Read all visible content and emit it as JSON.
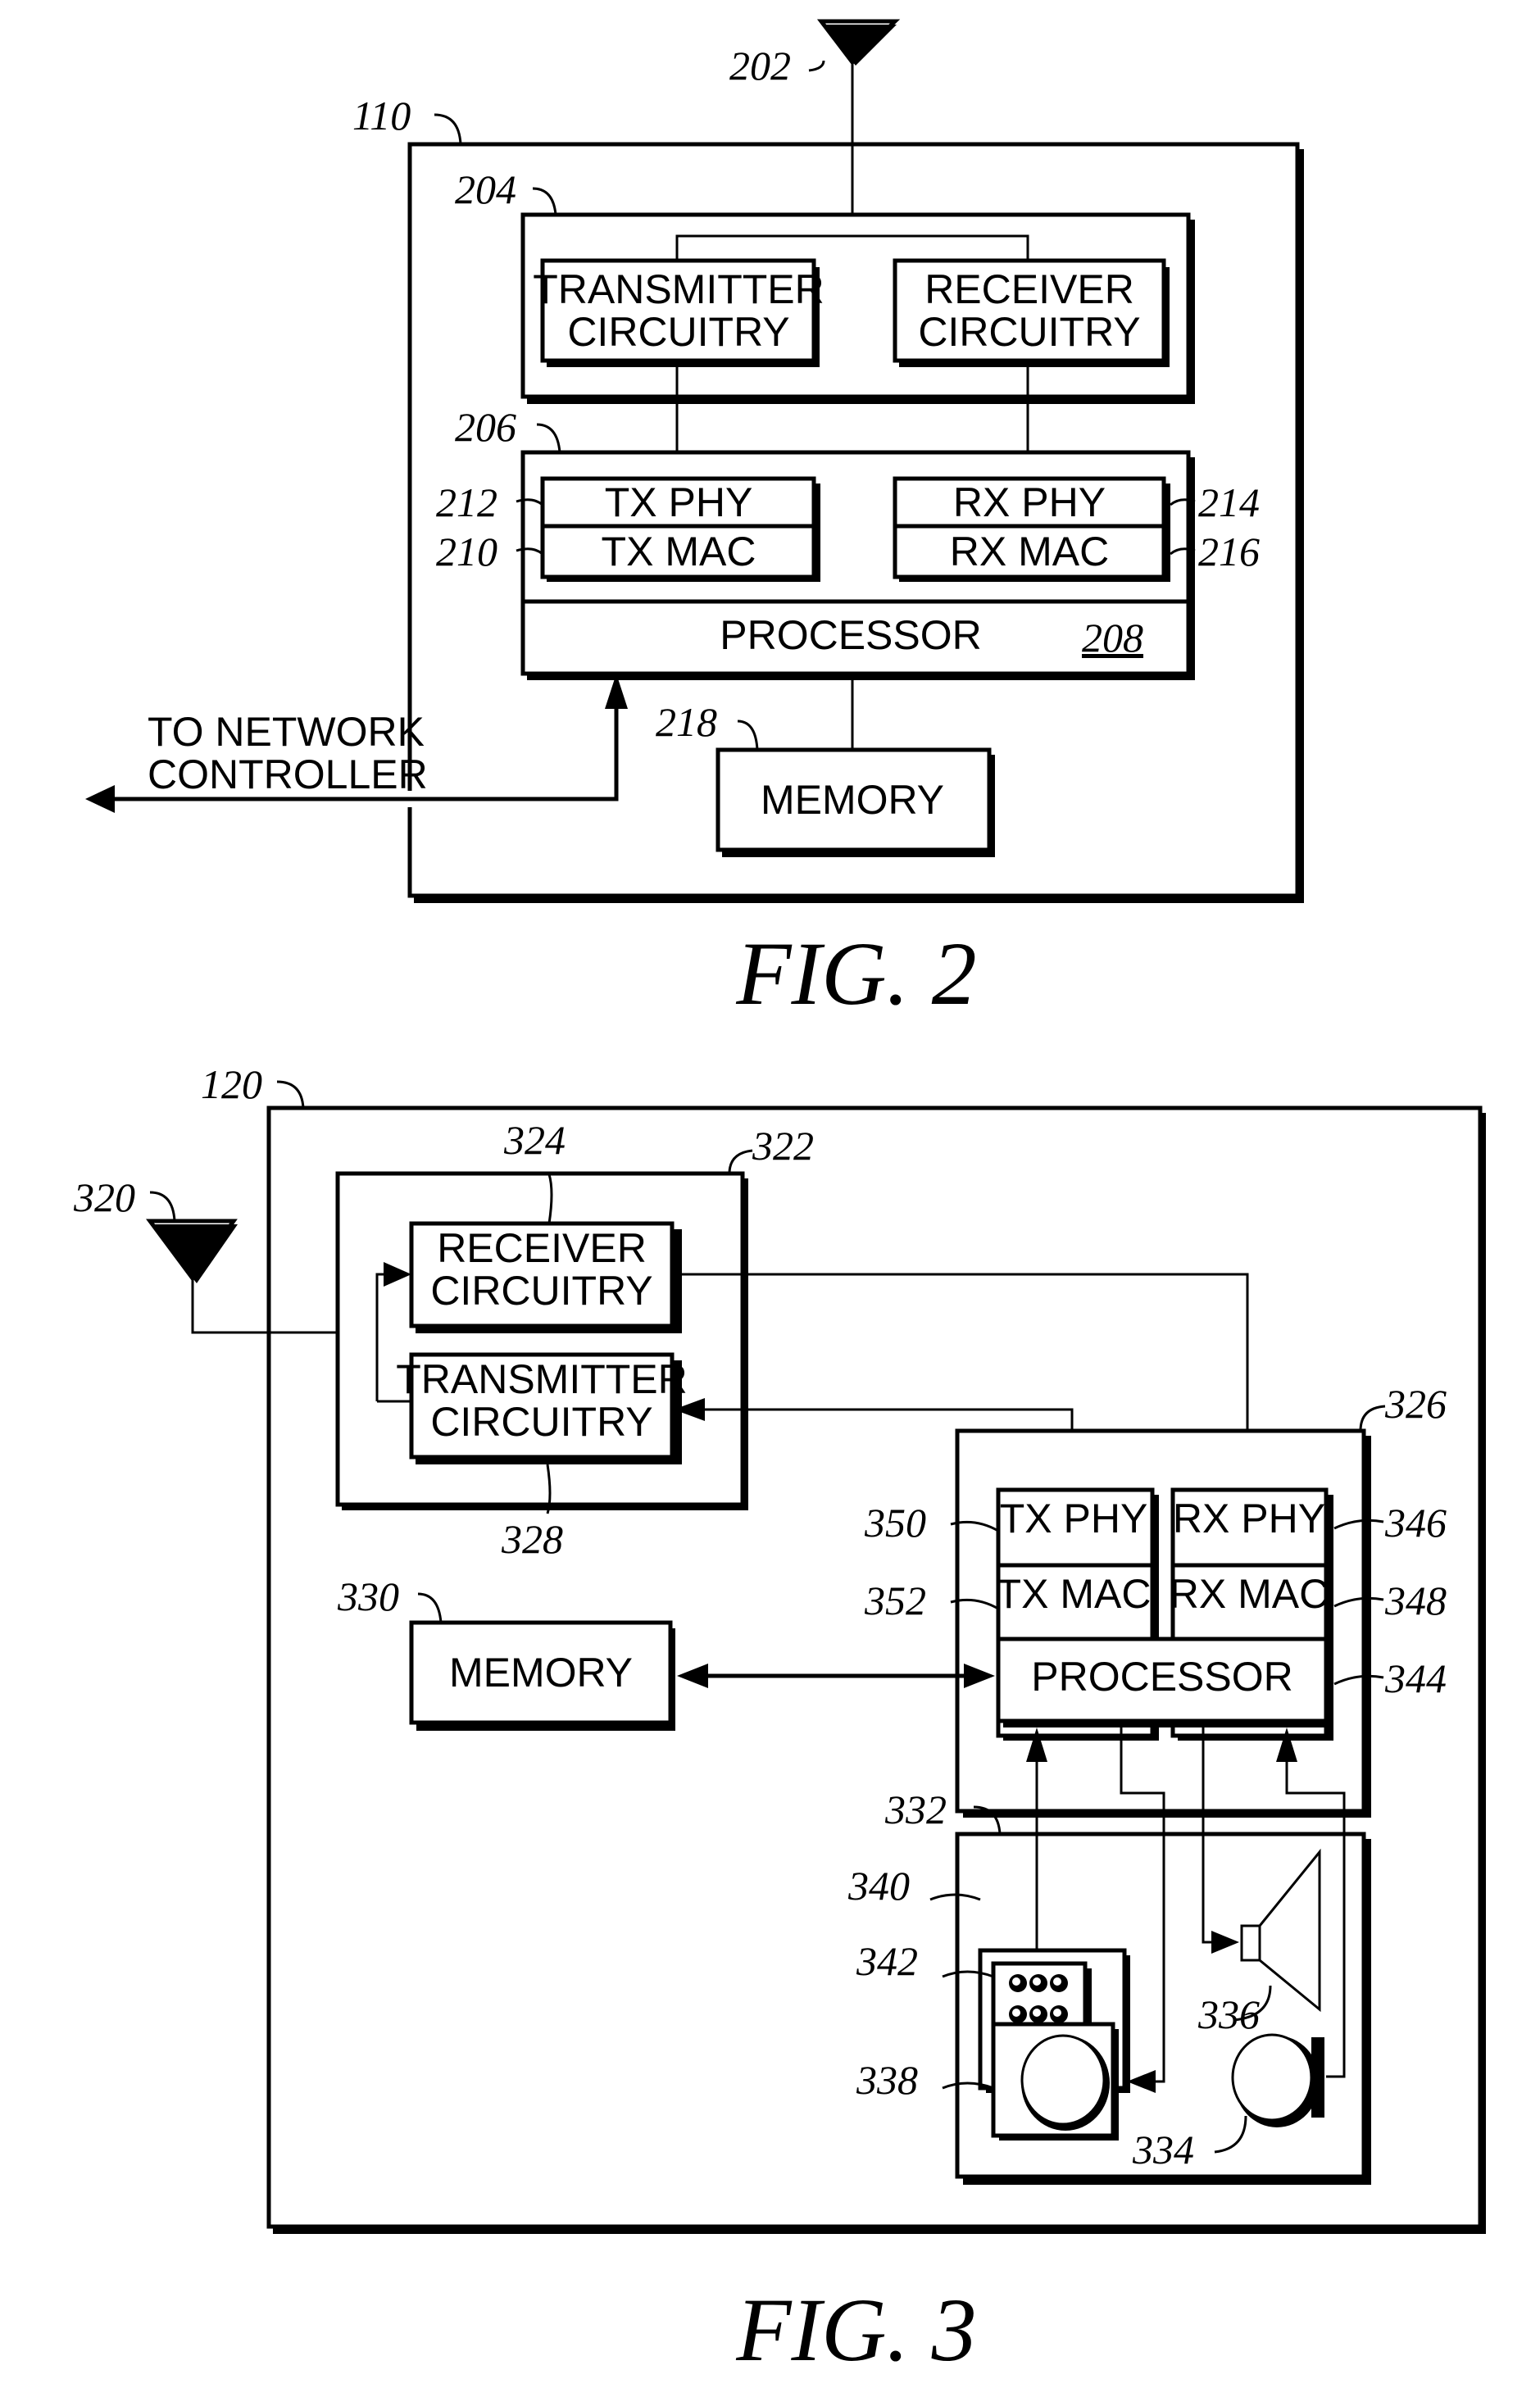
{
  "fig2": {
    "caption": "FIG. 2",
    "refs": {
      "device": "110",
      "antenna": "202",
      "transceiver": "204",
      "controller": "206",
      "processor": "208",
      "tx_mac": "210",
      "tx_phy": "212",
      "rx_phy": "214",
      "rx_mac": "216",
      "memory": "218"
    },
    "blocks": {
      "transmitter": [
        "TRANSMITTER",
        "CIRCUITRY"
      ],
      "receiver": [
        "RECEIVER",
        "CIRCUITRY"
      ],
      "tx_phy": "TX PHY",
      "tx_mac": "TX MAC",
      "rx_phy": "RX PHY",
      "rx_mac": "RX MAC",
      "processor": "PROCESSOR",
      "memory": "MEMORY",
      "network": [
        "TO NETWORK",
        "CONTROLLER"
      ]
    }
  },
  "fig3": {
    "caption": "FIG. 3",
    "refs": {
      "device": "120",
      "antenna": "320",
      "transceiver": "322",
      "receiver": "324",
      "controller": "326",
      "transmitter": "328",
      "memory": "330",
      "ui": "332",
      "microphone": "334",
      "speaker": "336",
      "display": "338",
      "keypad": "340",
      "keys": "342",
      "processor": "344",
      "rx_phy": "346",
      "rx_mac": "348",
      "tx_phy": "350",
      "tx_mac": "352"
    },
    "blocks": {
      "receiver": [
        "RECEIVER",
        "CIRCUITRY"
      ],
      "transmitter": [
        "TRANSMITTER",
        "CIRCUITRY"
      ],
      "tx_phy": "TX PHY",
      "tx_mac": "TX MAC",
      "rx_phy": "RX PHY",
      "rx_mac": "RX MAC",
      "processor": "PROCESSOR",
      "memory": "MEMORY"
    }
  }
}
